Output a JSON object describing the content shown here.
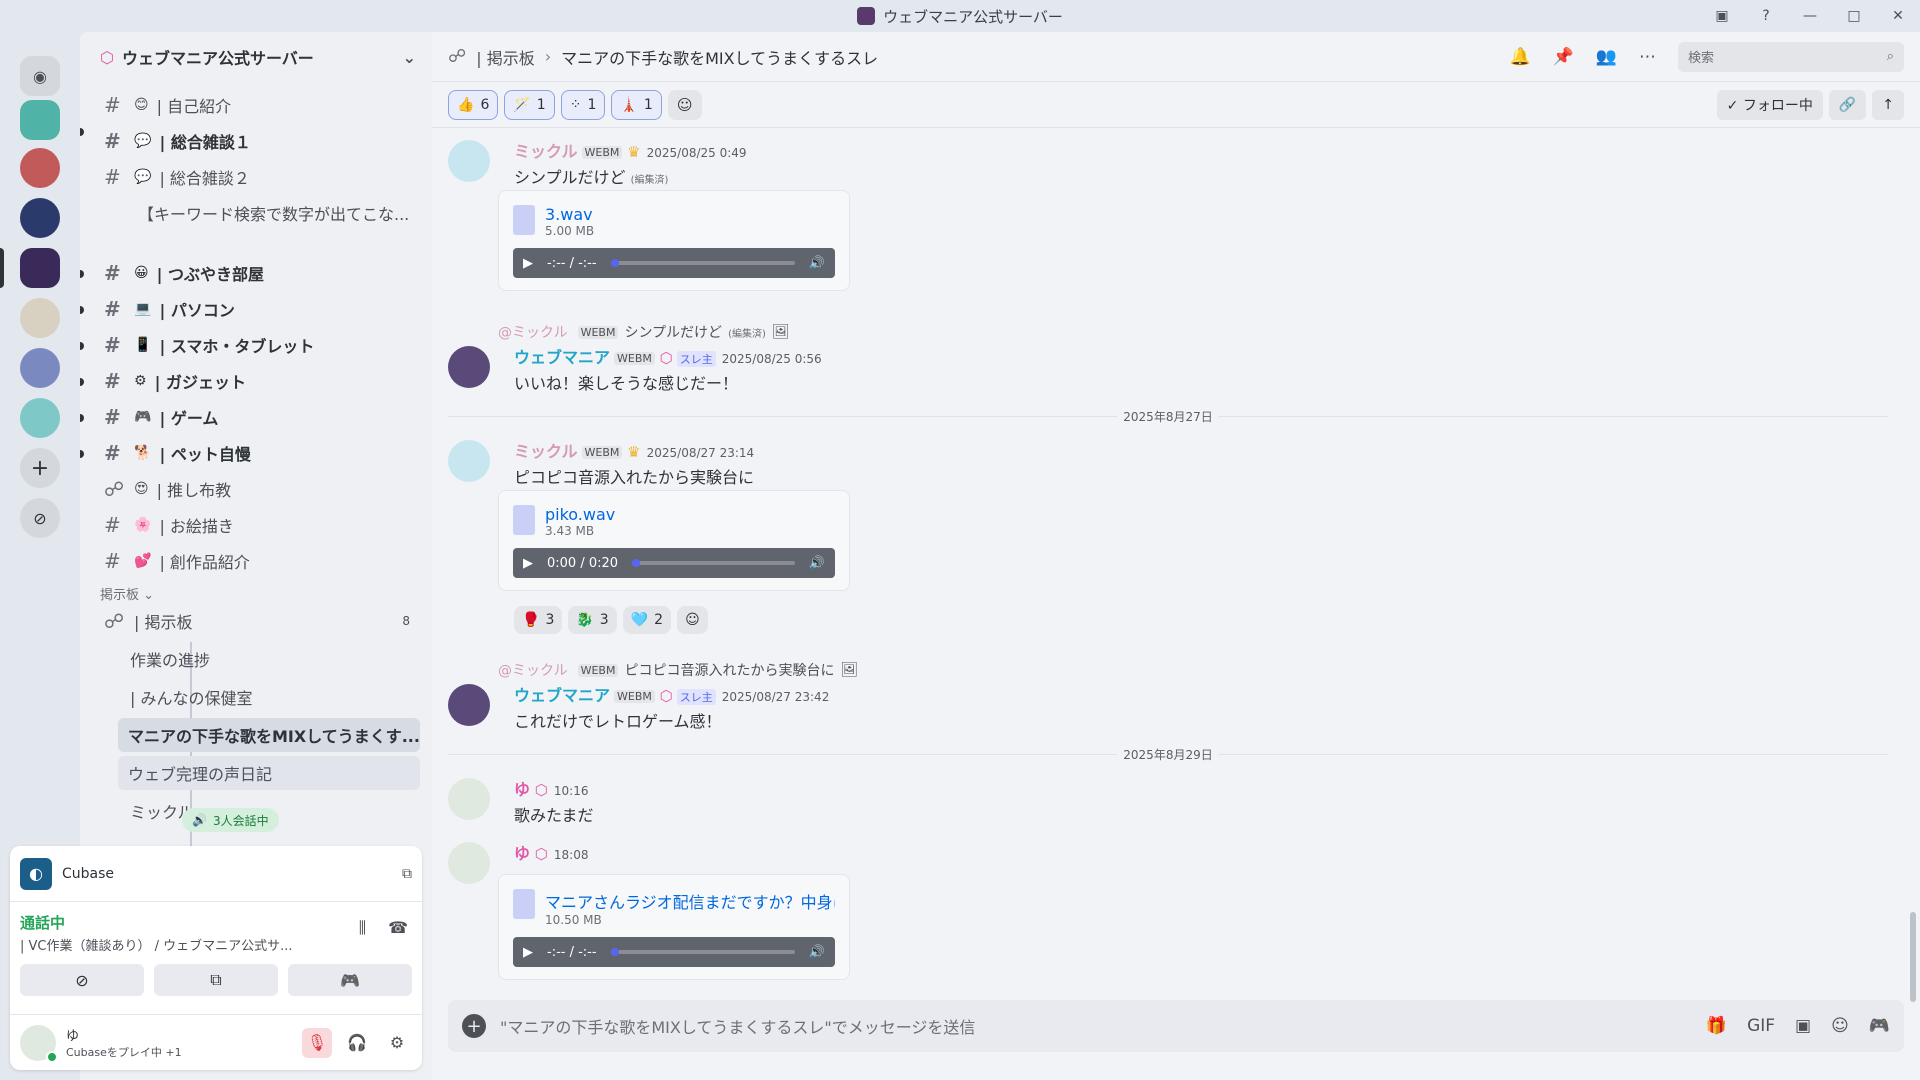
{
  "window": {
    "title": "ウェブマニア公式サーバー",
    "buttons": [
      "▣",
      "?",
      "—",
      "□",
      "✕"
    ]
  },
  "server": {
    "name": "ウェブマニア公式サーバー"
  },
  "channels": [
    {
      "emoji": "😊",
      "label": "| 自己紹介",
      "bold": false
    },
    {
      "emoji": "💬",
      "label": "| 総合雑談１",
      "bold": true
    },
    {
      "emoji": "💬",
      "label": "| 総合雑談２",
      "bold": false
    },
    {
      "emoji": "",
      "label": "【キーワード検索で数字が出てこな...",
      "bold": false
    },
    {
      "emoji": "😀",
      "label": "| つぶやき部屋",
      "bold": true
    },
    {
      "emoji": "💻",
      "label": "| パソコン",
      "bold": true
    },
    {
      "emoji": "📱",
      "label": "| スマホ・タブレット",
      "bold": true
    },
    {
      "emoji": "⚙",
      "label": "| ガジェット",
      "bold": true
    },
    {
      "emoji": "🎮",
      "label": "| ゲーム",
      "bold": true
    },
    {
      "emoji": "🐕",
      "label": "| ペット自慢",
      "bold": true
    },
    {
      "emoji": "😍",
      "label": "| 推し布教",
      "bold": false
    },
    {
      "emoji": "🌸",
      "label": "| お絵描き",
      "bold": false
    },
    {
      "emoji": "💕",
      "label": "| 創作品紹介",
      "bold": false
    }
  ],
  "category": {
    "label": "掲示板 ⌄"
  },
  "forum": {
    "label": "| 掲示板",
    "count": "8"
  },
  "threads": [
    {
      "label": "作業の進捗"
    },
    {
      "label": "| みんなの保健室"
    },
    {
      "label": "マニアの下手な歌をMIXしてうまくす..."
    },
    {
      "label": "ウェブ完理の声日記"
    },
    {
      "label": "ミックル"
    }
  ],
  "vc_badge": "3人会話中",
  "activity": {
    "app": "Cubase"
  },
  "voice": {
    "status": "通話中",
    "channel": "| VC作業（雑談あり） / ウェブマニア公式サ..."
  },
  "me": {
    "name": "ゆ",
    "activity": "Cubaseをプレイ中 +1"
  },
  "header": {
    "forum": "| 掲示板",
    "sep": "›",
    "thread": "マニアの下手な歌をMIXしてうまくするスレ",
    "search_placeholder": "検索"
  },
  "top_reactions": [
    {
      "emoji": "👍",
      "count": "6"
    },
    {
      "emoji": "🪄",
      "count": "1"
    },
    {
      "emoji": "⁘",
      "count": "1"
    },
    {
      "emoji": "🗼",
      "count": "1"
    }
  ],
  "follow": {
    "label": "✓ フォロー中"
  },
  "messages": {
    "m1": {
      "user": "ミックル",
      "tag": "WEBM",
      "ts": "2025/08/25 0:49",
      "text": "シンプルだけど",
      "edited": "(編集済)",
      "file": "3.wav",
      "size": "5.00 MB",
      "time": "-:-- / -:--"
    },
    "m2": {
      "reply_user": "@ミックル",
      "reply_tag": "WEBM",
      "reply_text": "シンプルだけど",
      "reply_edited": "(編集済)",
      "user": "ウェブマニア",
      "tag": "WEBM",
      "role": "スレ主",
      "ts": "2025/08/25 0:56",
      "text": "いいね！楽しそうな感じだー！"
    },
    "d1": "2025年8月27日",
    "m3": {
      "user": "ミックル",
      "tag": "WEBM",
      "ts": "2025/08/27 23:14",
      "text": "ピコピコ音源入れたから実験台に",
      "file": "piko.wav",
      "size": "3.43 MB",
      "time": "0:00 / 0:20",
      "reactions": [
        {
          "emoji": "🥊",
          "count": "3"
        },
        {
          "emoji": "🐉",
          "count": "3"
        },
        {
          "emoji": "🩵",
          "count": "2"
        }
      ]
    },
    "m4": {
      "reply_user": "@ミックル",
      "reply_tag": "WEBM",
      "reply_text": "ピコピコ音源入れたから実験台に",
      "user": "ウェブマニア",
      "tag": "WEBM",
      "role": "スレ主",
      "ts": "2025/08/27 23:42",
      "text": "これだけでレトロゲーム感！"
    },
    "d2": "2025年8月29日",
    "m5": {
      "user": "ゆ",
      "ts": "10:16",
      "text": "歌みたまだ"
    },
    "m6": {
      "user": "ゆ",
      "ts": "18:08",
      "file": "マニアさんラジオ配信まだですか？中身には関係ない",
      "size": "10.50 MB",
      "time": "-:-- / -:--"
    }
  },
  "composer": {
    "placeholder": "\"マニアの下手な歌をMIXしてうまくするスレ\"でメッセージを送信"
  },
  "colors": {
    "accent": "#5865f2",
    "online": "#23a55a",
    "mickle": "#d49bb3",
    "webmania": "#1fa6c8",
    "yu": "#e058a8"
  }
}
